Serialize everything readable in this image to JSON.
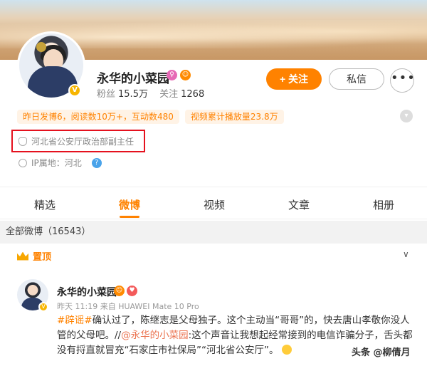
{
  "profile": {
    "name": "永华的小菜园",
    "fans_label": "粉丝",
    "fans_value": "15.5万",
    "following_label": "关注",
    "following_value": "1268",
    "follow_button": "+ 关注",
    "message_button": "私信",
    "more_button": "•••"
  },
  "pills": [
    "昨日发博6，阅读数10万+，互动数480",
    "视频累计播放量23.8万"
  ],
  "title": "河北省公安厅政治部副主任",
  "ip": "IP属地：河北",
  "tabs": [
    "精选",
    "微博",
    "视频",
    "文章",
    "相册"
  ],
  "active_tab": "微博",
  "all_weibo": "全部微博（16543）",
  "pinned_label": "置顶",
  "post": {
    "author": "永华的小菜园",
    "meta": "昨天 11:19 来自 HUAWEI Mate 10 Pro",
    "hashtag": "#辟谣#",
    "text_1": "确认过了，陈继志是父母独子。这个主动当“哥哥”的，快去唐山孝敬你没人管的父母吧。//",
    "mention": "@永华的小菜园",
    "text_2": ":这个声音让我想起经常接到的电信诈骗分子，舌头都没有捋直就冒充“石家庄市社保局”“河北省公安厅”。"
  },
  "watermark": "头条 @柳倩月",
  "colors": {
    "accent": "#ff8200",
    "highlight_border": "#e5111e",
    "link": "#eb7350"
  }
}
